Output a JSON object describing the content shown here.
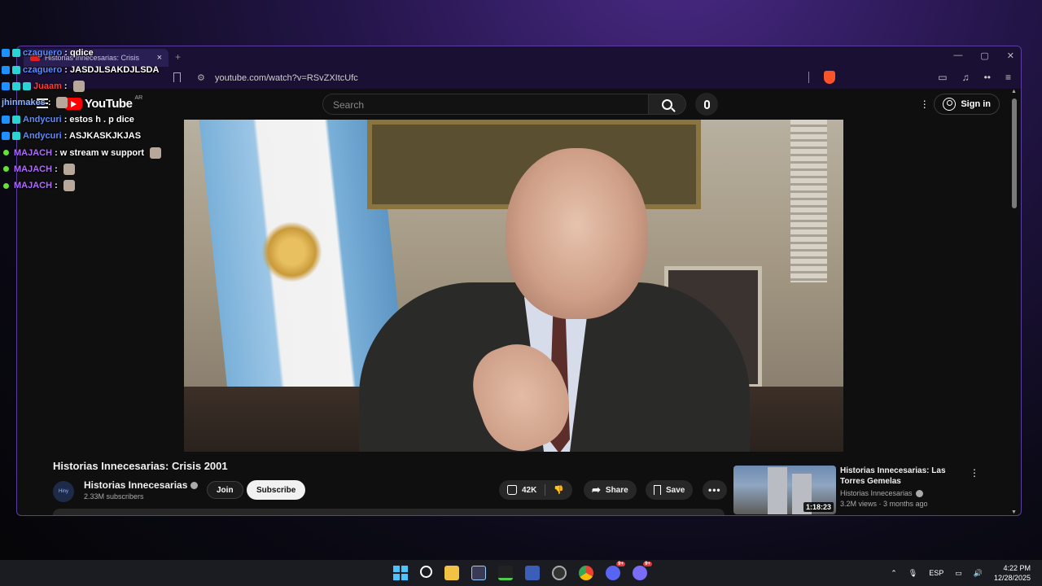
{
  "browser": {
    "tab_title": "Historias Innecesarias: Crisis",
    "tab_close": "×",
    "new_tab": "+",
    "url": "youtube.com/watch?v=RSvZXItcUfc",
    "window_controls": [
      "—",
      "▢",
      "✕"
    ]
  },
  "youtube": {
    "logo_text": "YouTube",
    "country_code": "AR",
    "search_placeholder": "Search",
    "sign_in": "Sign in"
  },
  "video": {
    "title": "Historias Innecesarias: Crisis 2001",
    "channel": "Historias Innecesarias",
    "avatar_text": "Hiny",
    "subscribers": "2.33M subscribers",
    "join": "Join",
    "subscribe": "Subscribe",
    "likes": "42K",
    "share": "Share",
    "save": "Save",
    "more": "•••"
  },
  "recommended": {
    "title": "Historias Innecesarias: Las Torres Gemelas",
    "channel": "Historias Innecesarias",
    "meta": "3.2M views · 3 months ago",
    "duration": "1:18:23"
  },
  "chat": [
    {
      "badges": [
        "prime",
        "sub"
      ],
      "user": "czaguero",
      "color": "#5b8cff",
      "message": ": qdice",
      "emote": false
    },
    {
      "badges": [
        "prime",
        "sub"
      ],
      "user": "czaguero",
      "color": "#5b8cff",
      "message": ": JASDJLSAKDJLSDA",
      "emote": false
    },
    {
      "badges": [
        "prime",
        "sub",
        "sub"
      ],
      "user": "Juaam",
      "color": "#ff3b3b",
      "message": ":",
      "emote": true
    },
    {
      "badges": [],
      "user": "jhinmakes",
      "color": "#8ab4ff",
      "message": ":",
      "emote": true
    },
    {
      "badges": [
        "prime",
        "sub"
      ],
      "user": "Andycuri",
      "color": "#5b8cff",
      "message": ": estos h . p dice",
      "emote": false
    },
    {
      "badges": [
        "prime",
        "sub"
      ],
      "user": "Andycuri",
      "color": "#5b8cff",
      "message": ": ASJKASKJKJAS",
      "emote": false
    },
    {
      "badges": [
        "dot"
      ],
      "user": "MAJACH",
      "color": "#b06bff",
      "message": ": w stream w support",
      "emote": true
    },
    {
      "badges": [
        "dot"
      ],
      "user": "MAJACH",
      "color": "#b06bff",
      "message": ":",
      "emote": true
    },
    {
      "badges": [
        "dot"
      ],
      "user": "MAJACH",
      "color": "#b06bff",
      "message": ":",
      "emote": true
    }
  ],
  "taskbar": {
    "language": "ESP",
    "time": "4:22 PM",
    "date": "12/28/2025",
    "pinned_icons": [
      "windows-start",
      "search",
      "file-explorer",
      "store",
      "terminal",
      "app-shield",
      "chrome-alt",
      "chrome",
      "discord",
      "discord-alt"
    ],
    "notification_badges": [
      "9+",
      "9+"
    ]
  }
}
